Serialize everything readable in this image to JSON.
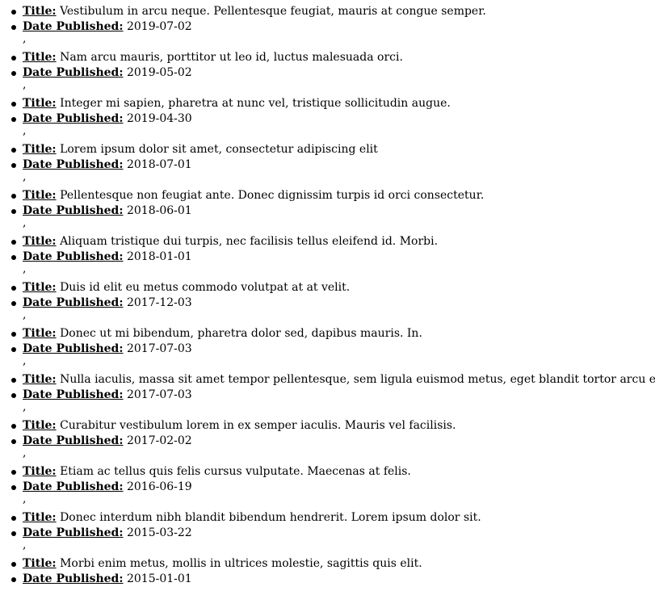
{
  "labels": {
    "title": "Title:",
    "date": "Date Published:",
    "separator": ","
  },
  "entries": [
    {
      "title": "Vestibulum in arcu neque. Pellentesque feugiat, mauris at congue semper.",
      "date": "2019-07-02"
    },
    {
      "title": "Nam arcu mauris, porttitor ut leo id, luctus malesuada orci.",
      "date": "2019-05-02"
    },
    {
      "title": "Integer mi sapien, pharetra at nunc vel, tristique sollicitudin augue.",
      "date": "2019-04-30"
    },
    {
      "title": "Lorem ipsum dolor sit amet, consectetur adipiscing elit",
      "date": "2018-07-01"
    },
    {
      "title": "Pellentesque non feugiat ante. Donec dignissim turpis id orci consectetur.",
      "date": "2018-06-01"
    },
    {
      "title": "Aliquam tristique dui turpis, nec facilisis tellus eleifend id. Morbi.",
      "date": "2018-01-01"
    },
    {
      "title": "Duis id elit eu metus commodo volutpat at at velit.",
      "date": "2017-12-03"
    },
    {
      "title": "Donec ut mi bibendum, pharetra dolor sed, dapibus mauris. In.",
      "date": "2017-07-03"
    },
    {
      "title": "Nulla iaculis, massa sit amet tempor pellentesque, sem ligula euismod metus, eget blandit tortor arcu eu nisl",
      "date": "2017-07-03"
    },
    {
      "title": "Curabitur vestibulum lorem in ex semper iaculis. Mauris vel facilisis.",
      "date": "2017-02-02"
    },
    {
      "title": "Etiam ac tellus quis felis cursus vulputate. Maecenas at felis.",
      "date": "2016-06-19"
    },
    {
      "title": "Donec interdum nibh blandit bibendum hendrerit. Lorem ipsum dolor sit.",
      "date": "2015-03-22"
    },
    {
      "title": "Morbi enim metus, mollis in ultrices molestie, sagittis quis elit.",
      "date": "2015-01-01"
    }
  ]
}
